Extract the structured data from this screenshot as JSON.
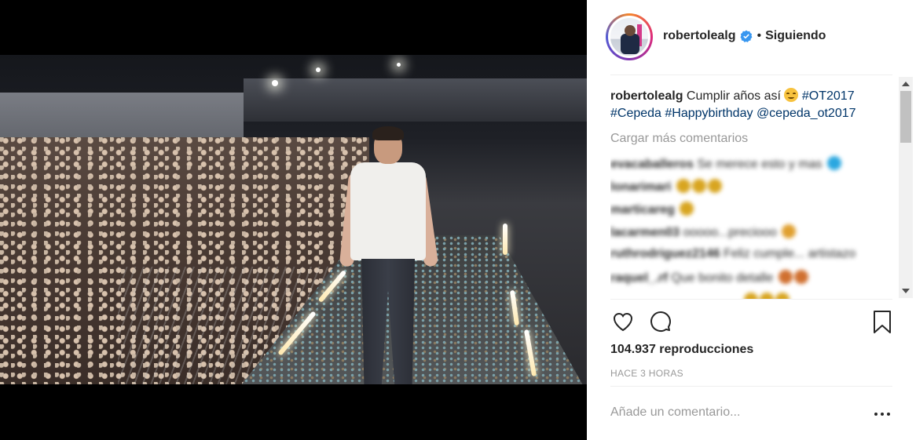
{
  "post": {
    "username": "robertolealg",
    "separator": "•",
    "follow_status": "Siguiendo",
    "caption_user": "robertolealg",
    "caption_text": "Cumplir años así",
    "tags": [
      "#OT2017",
      "#Cepeda",
      "#Happybirthday",
      "@cepeda_ot2017"
    ],
    "load_more": "Cargar más comentarios",
    "comments": [
      {
        "user": "evacaballeros",
        "text": "Se merece esto y mas",
        "emoji_color": "#2aa7e0"
      },
      {
        "user": "lonarimari",
        "text": "",
        "emoji_color": "#d8a520"
      },
      {
        "user": "marticareg",
        "text": "",
        "emoji_color": "#d8a520"
      },
      {
        "user": "lacarmen03",
        "text": "ooooo...preciooo",
        "emoji_color": "#e0a030"
      },
      {
        "user": "ruthrodriguez2146",
        "text": "Feliz cumple... artistazo",
        "emoji_color": ""
      },
      {
        "user": "raquel_.rf",
        "text": "Que bonito detalle",
        "emoji_color": "#d07030"
      }
    ],
    "views_count": "104.937",
    "views_label": "reproducciones",
    "timestamp": "HACE 3 HORAS",
    "comment_placeholder": "Añade un comentario...",
    "colors": {
      "link": "#003569",
      "verified": "#3897f0",
      "muted": "#999999"
    },
    "icons": [
      "verified-badge-icon",
      "heart-icon",
      "comment-icon",
      "bookmark-icon",
      "more-options-icon",
      "scroll-up-icon",
      "scroll-down-icon"
    ]
  }
}
